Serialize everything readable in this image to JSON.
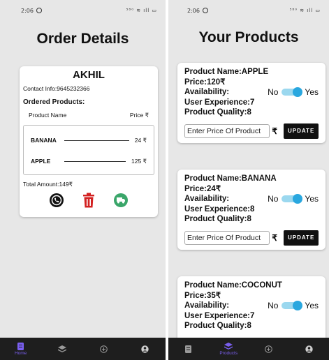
{
  "status_left": {
    "time": "2:06",
    "system": "⁵⁸⁰ ≋ ıll ▭"
  },
  "status_right": {
    "time": "2:06",
    "system": "⁵⁸⁰ ≋ ıll ▭"
  },
  "order_screen": {
    "title": "Order Details",
    "customer_name": "AKHIL",
    "contact": "Contact Info:9645232366",
    "ordered_heading": "Ordered Products:",
    "col_product": "Product Name",
    "col_price": "Price ₹",
    "items": [
      {
        "name": "BANANA",
        "price": "24 ₹"
      },
      {
        "name": "APPLE",
        "price": "125 ₹"
      }
    ],
    "total": "Total Amount:149₹",
    "actions": [
      "phone-icon",
      "trash-icon",
      "delivery-icon"
    ]
  },
  "products_screen": {
    "title": "Your Products",
    "products": [
      {
        "name": "Product Name:APPLE",
        "price": "Price:120₹",
        "availability_label": "Availability:",
        "no": "No",
        "yes": "Yes",
        "available": true,
        "experience": "User Experience:7",
        "quality": "Product Quality:8",
        "placeholder": "Enter Price Of Product",
        "rupee": "₹",
        "update": "UPDATE"
      },
      {
        "name": "Product Name:BANANA",
        "price": "Price:24₹",
        "availability_label": "Availability:",
        "no": "No",
        "yes": "Yes",
        "available": true,
        "experience": "User Experience:8",
        "quality": "Product Quality:8",
        "placeholder": "Enter Price Of Product",
        "rupee": "₹",
        "update": "UPDATE"
      },
      {
        "name": "Product Name:COCONUT",
        "price": "Price:35₹",
        "availability_label": "Availability:",
        "no": "No",
        "yes": "Yes",
        "available": true,
        "experience": "User Experience:7",
        "quality": "Product Quality:8"
      }
    ]
  },
  "tabbar_left": {
    "active": "Home",
    "active_label": "Home"
  },
  "tabbar_right": {
    "active": "Products",
    "active_label": "Products"
  },
  "colors": {
    "accent": "#7a5ff0",
    "toggle_on": "#29a7df",
    "delete": "#d32222",
    "delivery": "#3aa66a"
  }
}
